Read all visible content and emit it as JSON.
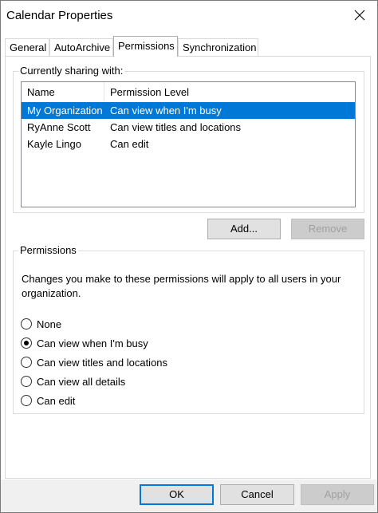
{
  "window": {
    "title": "Calendar Properties"
  },
  "tabs": [
    {
      "label": "General",
      "active": false
    },
    {
      "label": "AutoArchive",
      "active": false
    },
    {
      "label": "Permissions",
      "active": true
    },
    {
      "label": "Synchronization",
      "active": false
    }
  ],
  "sharing": {
    "group_label": "Currently sharing with:",
    "columns": [
      "Name",
      "Permission Level"
    ],
    "rows": [
      {
        "name": "My Organization",
        "level": "Can view when I'm busy",
        "selected": true
      },
      {
        "name": "RyAnne Scott",
        "level": "Can view titles and locations",
        "selected": false
      },
      {
        "name": "Kayle Lingo",
        "level": "Can edit",
        "selected": false
      }
    ],
    "add_label": "Add...",
    "remove_label": "Remove"
  },
  "permissions": {
    "group_label": "Permissions",
    "description": "Changes you make to these permissions will apply to all users in your organization.",
    "options": [
      {
        "label": "None",
        "checked": false
      },
      {
        "label": "Can view when I'm busy",
        "checked": true
      },
      {
        "label": "Can view titles and locations",
        "checked": false
      },
      {
        "label": "Can view all details",
        "checked": false
      },
      {
        "label": "Can edit",
        "checked": false
      }
    ]
  },
  "footer": {
    "ok_label": "OK",
    "cancel_label": "Cancel",
    "apply_label": "Apply"
  },
  "colors": {
    "selection": "#0078d7",
    "button_face": "#e1e1e1",
    "disabled_text": "#a0a0a0"
  }
}
